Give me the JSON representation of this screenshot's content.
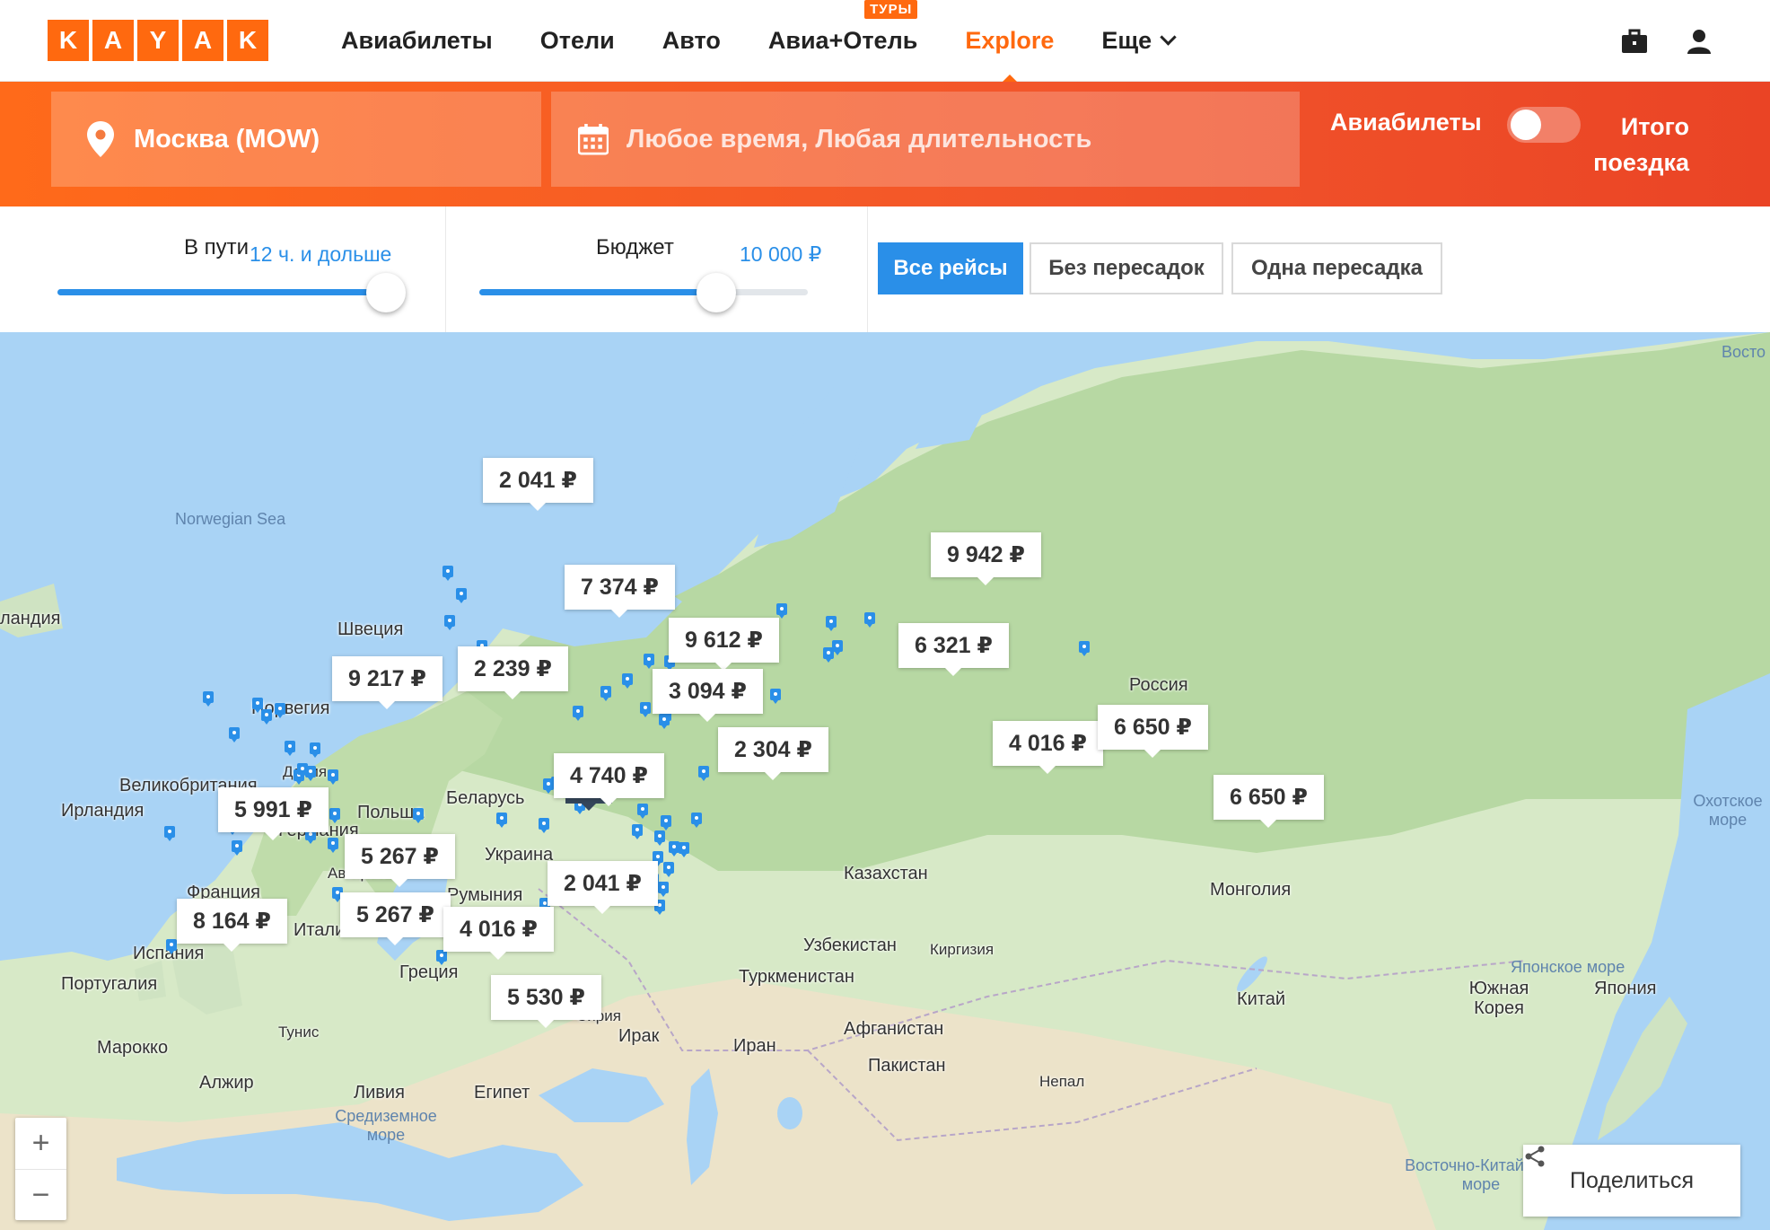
{
  "logo": {
    "letters": [
      "K",
      "A",
      "Y",
      "A",
      "K"
    ]
  },
  "nav": {
    "items": [
      {
        "label": "Авиабилеты"
      },
      {
        "label": "Отели"
      },
      {
        "label": "Авто"
      },
      {
        "label": "Авиа+Отель",
        "badge": "ТУРЫ"
      },
      {
        "label": "Explore",
        "active": true
      },
      {
        "label": "Еще"
      }
    ],
    "icons": [
      "briefcase-icon",
      "user-icon"
    ],
    "accent": "#ff690f"
  },
  "search": {
    "origin": "Москва (MOW)",
    "dates": "Любое время, Любая длительность",
    "toggle_left": "Авиабилеты",
    "toggle_right": "Итого поездка",
    "toggle_on": false
  },
  "filters": {
    "duration": {
      "label": "В пути",
      "value": "12 ч. и дольше",
      "level": 1.0
    },
    "budget": {
      "label": "Бюджет",
      "value": "10 000 ₽",
      "level": 0.72
    },
    "stops": [
      {
        "label": "Все рейсы",
        "selected": true
      },
      {
        "label": "Без пересадок",
        "selected": false
      },
      {
        "label": "Одна пересадка",
        "selected": false
      }
    ]
  },
  "map": {
    "countries": [
      {
        "name": "ландия"
      },
      {
        "name": "Швеция"
      },
      {
        "name": "Норвегия"
      },
      {
        "name": "Дания"
      },
      {
        "name": "Великобритания"
      },
      {
        "name": "Ирландия"
      },
      {
        "name": "Польша"
      },
      {
        "name": "Беларусь"
      },
      {
        "name": "Германия"
      },
      {
        "name": "Украина"
      },
      {
        "name": "Австрия"
      },
      {
        "name": "Франция"
      },
      {
        "name": "Румыния"
      },
      {
        "name": "Италия"
      },
      {
        "name": "Испания"
      },
      {
        "name": "Португалия"
      },
      {
        "name": "Греция"
      },
      {
        "name": "Тунис"
      },
      {
        "name": "Марокко"
      },
      {
        "name": "Алжир"
      },
      {
        "name": "Ливия"
      },
      {
        "name": "Египет"
      },
      {
        "name": "Сирия"
      },
      {
        "name": "Ирак"
      },
      {
        "name": "Иран"
      },
      {
        "name": "Казахстан"
      },
      {
        "name": "Узбекистан"
      },
      {
        "name": "Киргизия"
      },
      {
        "name": "Туркменистан"
      },
      {
        "name": "Афганистан"
      },
      {
        "name": "Пакистан"
      },
      {
        "name": "Непал"
      },
      {
        "name": "Монголия"
      },
      {
        "name": "Китай"
      },
      {
        "name": "Россия"
      },
      {
        "name": "Южная Корея"
      },
      {
        "name": "Япония"
      }
    ],
    "seas": [
      {
        "name": "Norwegian Sea"
      },
      {
        "name": "Средиземное море"
      },
      {
        "name": "Охотское море"
      },
      {
        "name": "Японское море"
      },
      {
        "name": "Восточно-Китайское море"
      },
      {
        "name": "Восто"
      }
    ],
    "prices": [
      {
        "label": "2 041 ₽"
      },
      {
        "label": "7 374 ₽"
      },
      {
        "label": "9 942 ₽"
      },
      {
        "label": "9 612 ₽"
      },
      {
        "label": "6 321 ₽"
      },
      {
        "label": "9 217 ₽"
      },
      {
        "label": "2 239 ₽"
      },
      {
        "label": "3 094 ₽"
      },
      {
        "label": "2 304 ₽"
      },
      {
        "label": "4 016 ₽"
      },
      {
        "label": "6 650 ₽"
      },
      {
        "label": "4 740 ₽"
      },
      {
        "label": "6 650 ₽"
      },
      {
        "label": "5 991 ₽"
      },
      {
        "label": "5 267 ₽"
      },
      {
        "label": "2 041 ₽"
      },
      {
        "label": "5 267 ₽"
      },
      {
        "label": "8 164 ₽"
      },
      {
        "label": "4 016 ₽"
      },
      {
        "label": "5 530 ₽"
      }
    ],
    "origin_marker": "★",
    "zoom_in": "+",
    "zoom_out": "−",
    "share_label": "Поделиться"
  }
}
